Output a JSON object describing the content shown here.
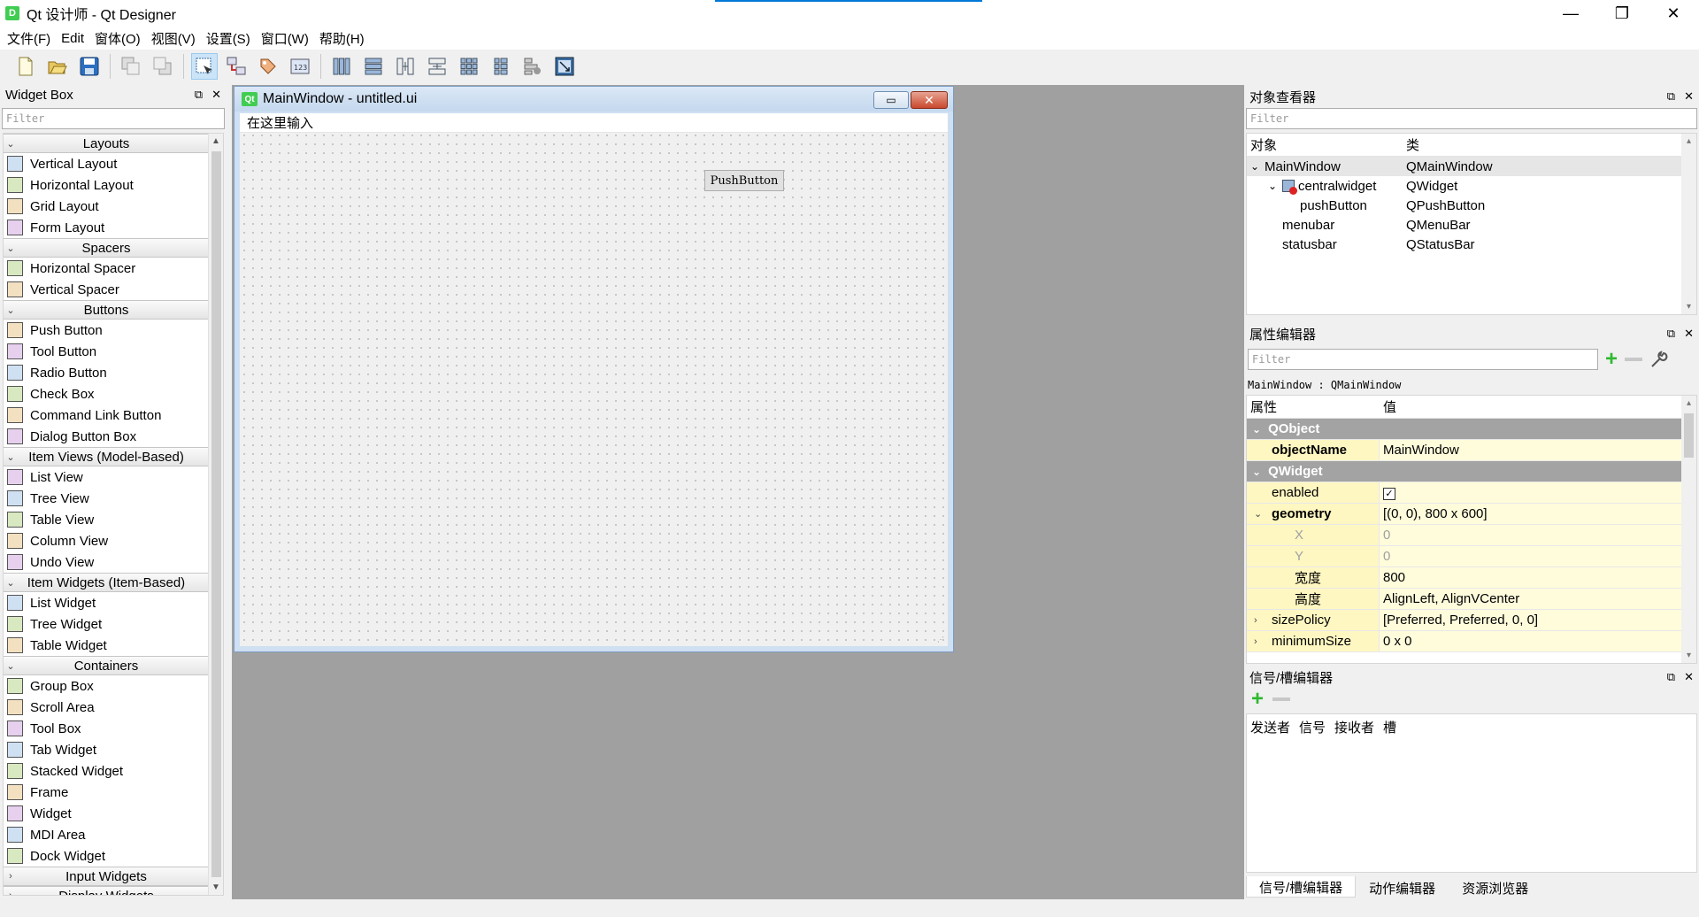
{
  "window": {
    "title": "Qt 设计师 - Qt Designer",
    "app_icon": "qt-designer-icon",
    "min_glyph": "—",
    "max_glyph": "❐",
    "close_glyph": "✕"
  },
  "menubar": [
    "文件(F)",
    "Edit",
    "窗体(O)",
    "视图(V)",
    "设置(S)",
    "窗口(W)",
    "帮助(H)"
  ],
  "toolbar": {
    "groups": [
      [
        "new-icon",
        "open-icon",
        "save-icon"
      ],
      [
        "send-to-back-icon",
        "bring-to-front-icon"
      ],
      [
        "edit-widgets-icon",
        "edit-signals-slots-icon",
        "edit-buddies-icon",
        "edit-tab-order-icon"
      ],
      [
        "layout-horizontal-icon",
        "layout-vertical-icon",
        "layout-h-splitter-icon",
        "layout-v-splitter-icon",
        "layout-grid-icon",
        "layout-form-icon",
        "break-layout-icon",
        "adjust-size-icon"
      ]
    ]
  },
  "widget_box": {
    "title": "Widget Box",
    "float_glyph": "⧉",
    "close_glyph": "✕",
    "filter_placeholder": "Filter",
    "categories": [
      {
        "label": "Layouts",
        "expanded": true,
        "items": [
          "Vertical Layout",
          "Horizontal Layout",
          "Grid Layout",
          "Form Layout"
        ]
      },
      {
        "label": "Spacers",
        "expanded": true,
        "items": [
          "Horizontal Spacer",
          "Vertical Spacer"
        ]
      },
      {
        "label": "Buttons",
        "expanded": true,
        "items": [
          "Push Button",
          "Tool Button",
          "Radio Button",
          "Check Box",
          "Command Link Button",
          "Dialog Button Box"
        ]
      },
      {
        "label": "Item Views (Model-Based)",
        "expanded": true,
        "items": [
          "List View",
          "Tree View",
          "Table View",
          "Column View",
          "Undo View"
        ]
      },
      {
        "label": "Item Widgets (Item-Based)",
        "expanded": true,
        "items": [
          "List Widget",
          "Tree Widget",
          "Table Widget"
        ]
      },
      {
        "label": "Containers",
        "expanded": true,
        "items": [
          "Group Box",
          "Scroll Area",
          "Tool Box",
          "Tab Widget",
          "Stacked Widget",
          "Frame",
          "Widget",
          "MDI Area",
          "Dock Widget"
        ]
      },
      {
        "label": "Input Widgets",
        "expanded": false,
        "items": []
      },
      {
        "label": "Display Widgets",
        "expanded": false,
        "items": []
      }
    ]
  },
  "form": {
    "title": "MainWindow - untitled.ui",
    "qt_badge": "Qt",
    "menu_placeholder": "在这里输入",
    "push_button_label": "PushButton",
    "min_glyph": "▭",
    "close_glyph": "✕"
  },
  "object_inspector": {
    "title": "对象查看器",
    "float_glyph": "⧉",
    "close_glyph": "✕",
    "filter_placeholder": "Filter",
    "col_object": "对象",
    "col_class": "类",
    "rows": [
      {
        "object": "MainWindow",
        "class": "QMainWindow",
        "depth": 0,
        "expander": "⌄",
        "selected": true
      },
      {
        "object": "centralwidget",
        "class": "QWidget",
        "depth": 1,
        "expander": "⌄",
        "selected": false
      },
      {
        "object": "pushButton",
        "class": "QPushButton",
        "depth": 2,
        "expander": "",
        "selected": false
      },
      {
        "object": "menubar",
        "class": "QMenuBar",
        "depth": 1,
        "expander": "",
        "selected": false
      },
      {
        "object": "statusbar",
        "class": "QStatusBar",
        "depth": 1,
        "expander": "",
        "selected": false
      }
    ]
  },
  "property_editor": {
    "title": "属性编辑器",
    "float_glyph": "⧉",
    "close_glyph": "✕",
    "filter_placeholder": "Filter",
    "context": "MainWindow : QMainWindow",
    "col_property": "属性",
    "col_value": "值",
    "rows": [
      {
        "type": "group",
        "name": "QObject"
      },
      {
        "type": "prop",
        "name": "objectName",
        "value": "MainWindow",
        "bold": true,
        "yellow": true
      },
      {
        "type": "group",
        "name": "QWidget"
      },
      {
        "type": "prop",
        "name": "enabled",
        "value": "",
        "checkbox": true,
        "yellow": true
      },
      {
        "type": "prop",
        "name": "geometry",
        "value": "[(0, 0), 800 x 600]",
        "bold": true,
        "expander": "⌄",
        "yellow": true
      },
      {
        "type": "sub",
        "name": "X",
        "value": "0",
        "disabled": true,
        "yellow": true
      },
      {
        "type": "sub",
        "name": "Y",
        "value": "0",
        "disabled": true,
        "yellow": true
      },
      {
        "type": "sub",
        "name": "宽度",
        "value": "800",
        "yellow": true
      },
      {
        "type": "sub",
        "name": "高度",
        "value": "AlignLeft, AlignVCenter",
        "yellow": true
      },
      {
        "type": "prop",
        "name": "sizePolicy",
        "value": "[Preferred, Preferred, 0, 0]",
        "expander": "›",
        "yellow": true
      },
      {
        "type": "prop",
        "name": "minimumSize",
        "value": "0 x 0",
        "expander": "›",
        "yellow": true
      }
    ]
  },
  "signal_editor": {
    "title": "信号/槽编辑器",
    "float_glyph": "⧉",
    "close_glyph": "✕",
    "columns": [
      "发送者",
      "信号",
      "接收者",
      "槽"
    ],
    "tabs": [
      {
        "label": "信号/槽编辑器",
        "active": true
      },
      {
        "label": "动作编辑器",
        "active": false
      },
      {
        "label": "资源浏览器",
        "active": false
      }
    ]
  }
}
